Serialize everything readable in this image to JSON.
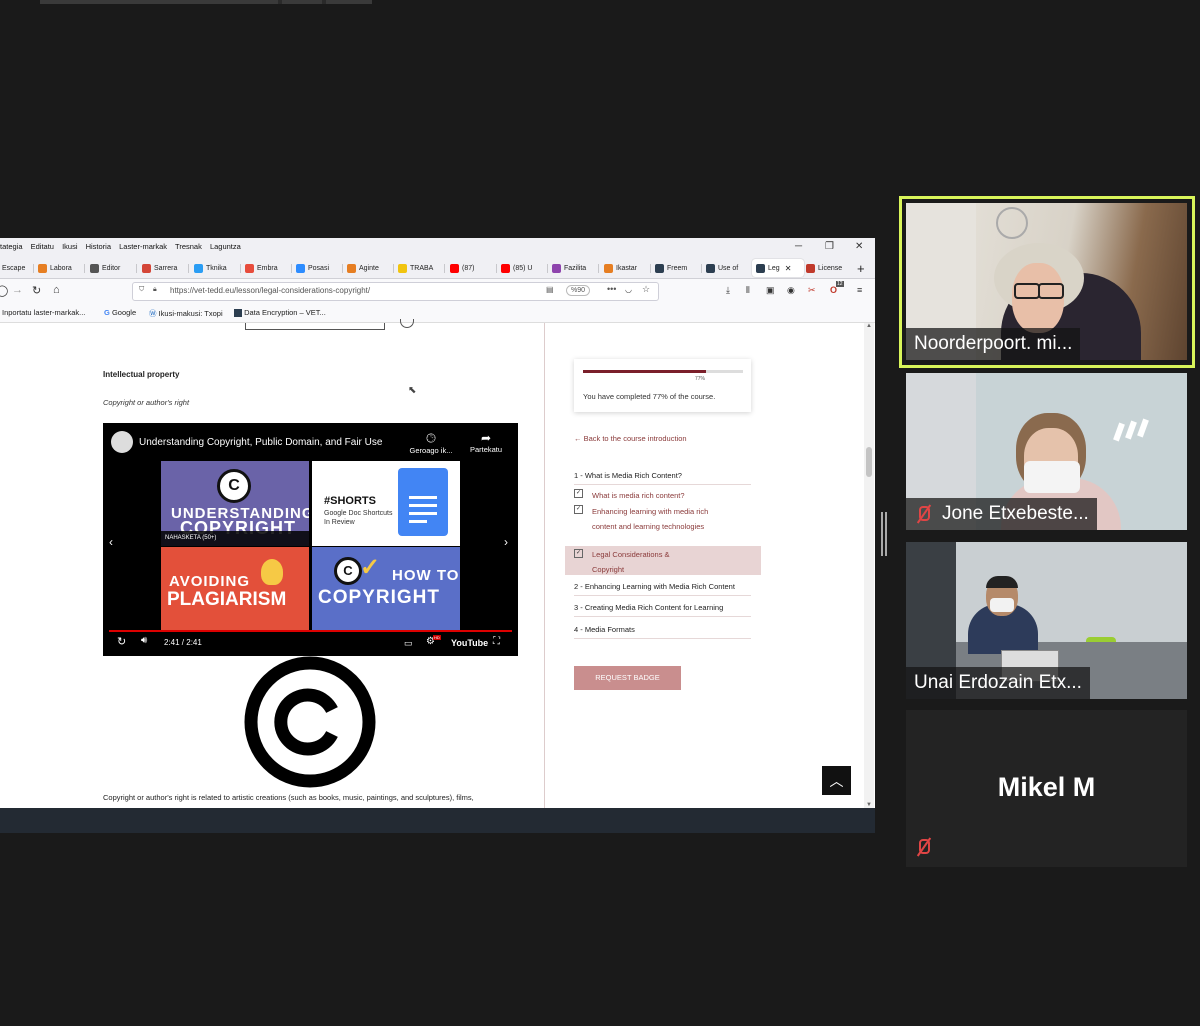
{
  "browser": {
    "menu": [
      "tategia",
      "Editatu",
      "Ikusi",
      "Historia",
      "Laster-markak",
      "Tresnak",
      "Laguntza"
    ],
    "tabs": [
      {
        "label": "Escape",
        "color": "#c0392b"
      },
      {
        "label": "Labora",
        "color": "#e67e22"
      },
      {
        "label": "Editor",
        "color": "#555555"
      },
      {
        "label": "Sarrera",
        "color": "#d44638"
      },
      {
        "label": "Tknika",
        "color": "#2a9df4"
      },
      {
        "label": "Embra",
        "color": "#e74c3c"
      },
      {
        "label": "Posasi",
        "color": "#2d8cff"
      },
      {
        "label": "Aginte",
        "color": "#e67e22"
      },
      {
        "label": "TRABA",
        "color": "#f1c40f"
      },
      {
        "label": "(87)",
        "color": "#ff0000"
      },
      {
        "label": "(85) U",
        "color": "#ff0000"
      },
      {
        "label": "Fazilita",
        "color": "#8e44ad"
      },
      {
        "label": "Ikastar",
        "color": "#e67e22"
      },
      {
        "label": "Freem",
        "color": "#2c3e50"
      },
      {
        "label": "Use of",
        "color": "#2c3e50"
      },
      {
        "label": "Leg",
        "color": "#2c3e50"
      },
      {
        "label": "License",
        "color": "#c0392b"
      }
    ],
    "url": "https://vet-tedd.eu/lesson/legal-considerations-copyright/",
    "zoom": "%90",
    "bookmarks": [
      "Inportatu laster-markak...",
      "Google",
      "Ikusi-makusi: Txopi",
      "Data Encryption – VET..."
    ],
    "notif_count": "12"
  },
  "lesson": {
    "heading": "Intellectual property",
    "subheading": "Copyright or author's right",
    "body_text": "Copyright or author's right is related to artistic creations (such as books, music, paintings, and sculptures), films,"
  },
  "video": {
    "title": "Understanding Copyright, Public Domain, and Fair Use",
    "watch_later": "Geroago ik...",
    "share": "Partekatu",
    "thumb1_top": "UNDERSTANDING",
    "thumb1_bottom": "COPYRIGHT",
    "thumb1_badge": "NAHASKETA (50+)",
    "thumb2_title": "#SHORTS",
    "thumb2_sub1": "Google Doc Shortcuts",
    "thumb2_sub2": "In Review",
    "thumb3_top": "AVOIDING",
    "thumb3_bottom": "PLAGIARISM",
    "thumb4_top": "HOW TO",
    "thumb4_bottom": "COPYRIGHT",
    "time": "2:41 / 2:41",
    "brand": "YouTube",
    "hd": "HD"
  },
  "sidebar": {
    "progress_percent": 77,
    "progress_label": "77%",
    "progress_text": "You have completed 77% of the course.",
    "back_link": "← Back to the course introduction",
    "sections": [
      {
        "label": "1 - What is Media Rich Content?"
      },
      {
        "label": "2 - Enhancing Learning with Media Rich Content"
      },
      {
        "label": "3 - Creating Media Rich Content for Learning"
      },
      {
        "label": "4 - Media Formats"
      }
    ],
    "lessons": [
      {
        "label": "What is media rich content?"
      },
      {
        "label": "Enhancing learning with media rich content and learning technologies"
      },
      {
        "label": "Legal Considerations & Copyright"
      }
    ],
    "badge_button": "REQUEST BADGE"
  },
  "participants": [
    {
      "name": "Noorderpoort. mi..."
    },
    {
      "name": "Jone Etxebeste..."
    },
    {
      "name": "Unai Erdozain Etx..."
    },
    {
      "name": "Mikel M"
    }
  ],
  "colors": {
    "accent": "#7a1f2a",
    "link": "#8a3a3a",
    "active_speaker": "#d9f55a",
    "badge": "#c98e8e"
  }
}
